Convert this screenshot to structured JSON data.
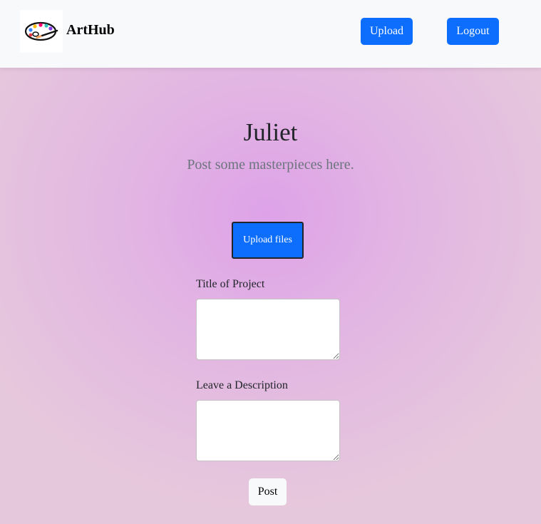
{
  "navbar": {
    "brand": "ArtHub",
    "logo_icon": "paint-palette-icon",
    "upload_label": "Upload",
    "logout_label": "Logout"
  },
  "profile": {
    "name": "Juliet",
    "tagline": "Post some masterpieces here."
  },
  "form": {
    "upload_files_label": "Upload files",
    "title_label": "Title of Project",
    "title_value": "",
    "description_label": "Leave a Description",
    "description_value": "",
    "post_label": "Post"
  },
  "colors": {
    "primary": "#0d6efd",
    "navbar_bg": "#f8f9fa",
    "background_center": "#dea2e8",
    "background_edge": "#e6c8dc",
    "subtitle": "#6c757d"
  }
}
